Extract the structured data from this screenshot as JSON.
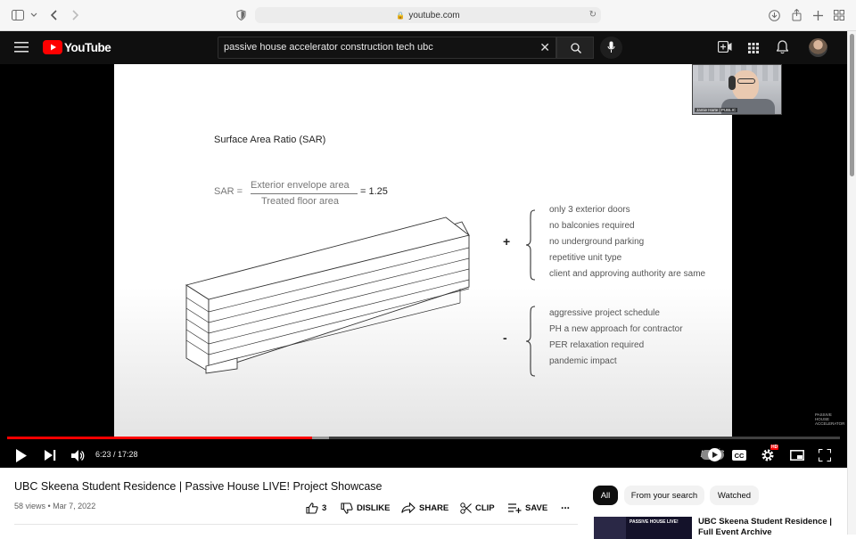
{
  "browser": {
    "url": "youtube.com",
    "icons": [
      "sidebar-icon",
      "chevron-down-icon",
      "back-icon",
      "forward-icon",
      "shield-icon",
      "lock-icon",
      "reload-icon",
      "download-icon",
      "share-icon",
      "plus-icon",
      "tabs-grid-icon"
    ]
  },
  "header": {
    "logo_text": "YouTube",
    "search_value": "passive house accelerator construction tech ubc",
    "icons": [
      "menu-icon",
      "youtube-logo-icon",
      "clear-icon",
      "search-icon",
      "mic-icon",
      "create-icon",
      "apps-icon",
      "bell-icon",
      "avatar"
    ]
  },
  "slide": {
    "title": "Surface Area Ratio (SAR)",
    "sar_label": "SAR =",
    "numerator": "Exterior envelope area",
    "denominator": "Treated floor area",
    "result": "= 1.25",
    "plus_sign": "+",
    "minus_sign": "-",
    "pros": [
      "only 3 exterior doors",
      "no balconies required",
      "no underground parking",
      "repetitive unit type",
      "client and approving authority are same"
    ],
    "cons": [
      "aggressive project schedule",
      "PH a new approach for contractor",
      "PER relaxation required",
      "pandemic impact"
    ]
  },
  "webcam": {
    "label": "Jamie Harte | PUBLIC"
  },
  "watermark": "PASSIVE HOUSE ACCELERATOR",
  "player": {
    "time": "6:23 / 17:28",
    "progress_played": 0.366,
    "progress_buffered": 0.386,
    "brand_logo": "public",
    "settings_badge": "HD",
    "controls": [
      "play-icon",
      "next-icon",
      "volume-icon",
      "autoplay-toggle",
      "captions-icon",
      "settings-icon",
      "miniplayer-icon",
      "fullscreen-icon"
    ]
  },
  "video": {
    "title": "UBC Skeena Student Residence | Passive House LIVE! Project Showcase",
    "meta": "58 views • Mar 7, 2022",
    "likes": "3",
    "dislike_label": "DISLIKE",
    "share_label": "SHARE",
    "clip_label": "CLIP",
    "save_label": "SAVE",
    "more_label": "..."
  },
  "chips": [
    "All",
    "From your search",
    "Watched"
  ],
  "related": {
    "title": "UBC Skeena Student Residence | Full Event Archive",
    "thumb_text": "PASSIVE HOUSE LIVE!"
  },
  "colors": {
    "accent": "#ff0000",
    "header_bg": "#0f0f0f",
    "chip_active": "#0f0f0f"
  }
}
